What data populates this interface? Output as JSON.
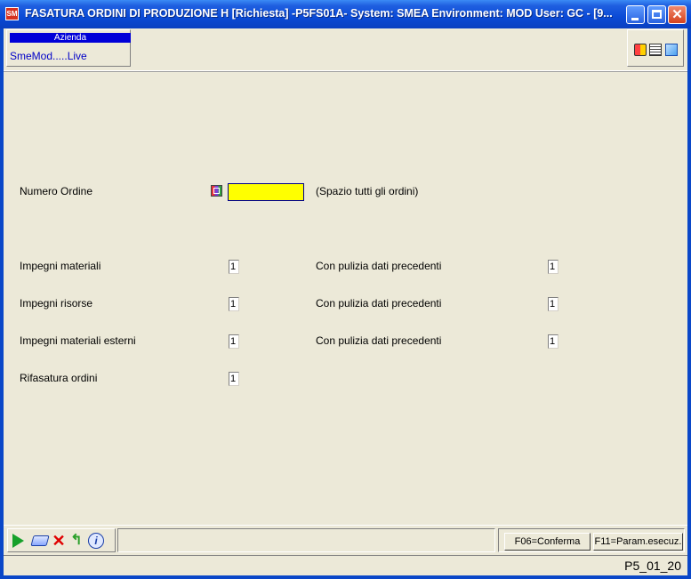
{
  "window": {
    "title": "FASATURA ORDINI DI PRODUZIONE H [Richiesta] -P5FS01A- System: SMEA Environment: MOD User: GC - [9...",
    "app_icon": "app-icon",
    "title_controls": [
      "minimize-icon",
      "maximize-icon",
      "close-icon"
    ]
  },
  "header": {
    "azienda_label": "Azienda",
    "azienda_value": "SmeMod.....Live",
    "tool_icons": [
      "monitor-icon",
      "document-icon",
      "help-book-icon"
    ]
  },
  "form": {
    "numero_ordine_label": "Numero Ordine",
    "numero_ordine_value": "",
    "numero_ordine_hint": "(Spazio tutti gli ordini)",
    "rows": [
      {
        "label": "Impegni materiali",
        "value": "1",
        "cleanup_label": "Con pulizia dati precedenti",
        "cleanup_value": "1"
      },
      {
        "label": "Impegni risorse",
        "value": "1",
        "cleanup_label": "Con pulizia dati precedenti",
        "cleanup_value": "1"
      },
      {
        "label": "Impegni materiali esterni",
        "value": "1",
        "cleanup_label": "Con pulizia dati precedenti",
        "cleanup_value": "1"
      },
      {
        "label": "Rifasatura ordini",
        "value": "1"
      }
    ]
  },
  "toolbar": {
    "icons": [
      "run-icon",
      "clear-icon",
      "cancel-icon",
      "back-icon",
      "info-icon"
    ],
    "f06_label": "F06=Conferma",
    "f11_label": "F11=Param.esecuz."
  },
  "status": {
    "code": "P5_01_20"
  },
  "colors": {
    "title_bar": "#0a4ad6",
    "window_bg": "#ece9d8",
    "input_highlight": "#ffff00",
    "azienda_header": "#0000d8"
  }
}
